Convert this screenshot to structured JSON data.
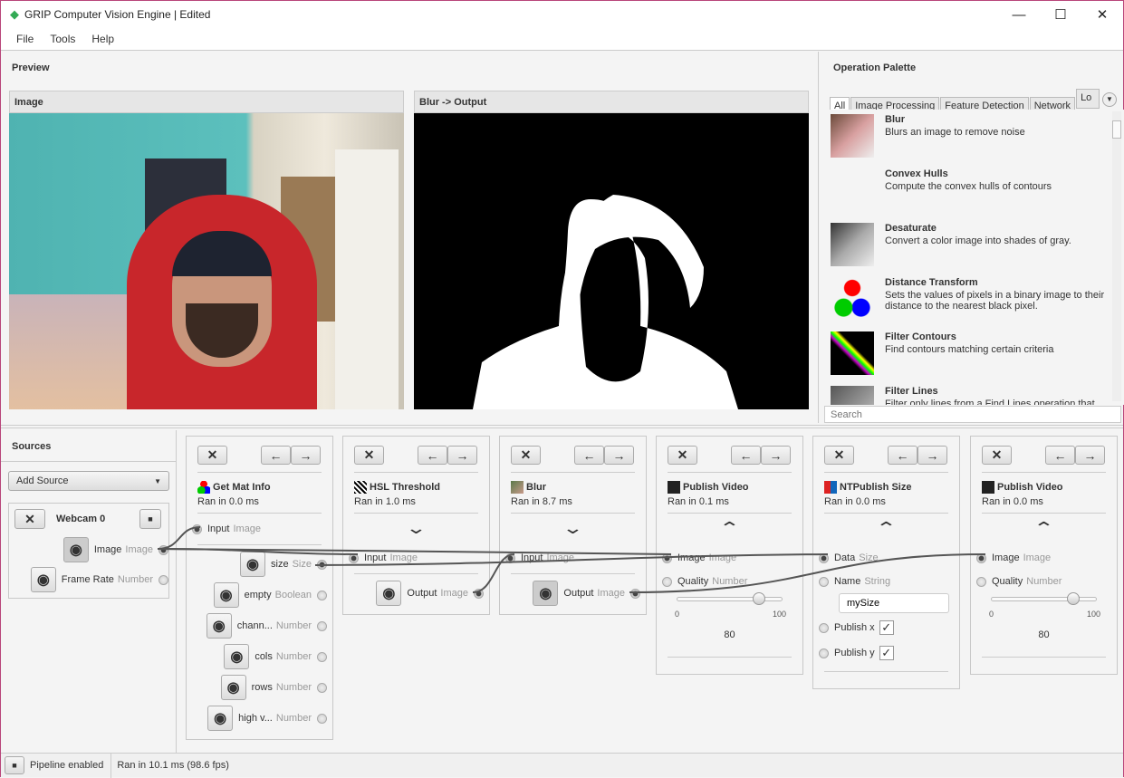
{
  "window": {
    "title": "GRIP Computer Vision Engine | Edited",
    "minimize": "—",
    "maximize": "☐",
    "close": "✕"
  },
  "menu": [
    "File",
    "Tools",
    "Help"
  ],
  "preview": {
    "title": "Preview",
    "panels": [
      {
        "title": "Image"
      },
      {
        "title": "Blur -> Output"
      }
    ]
  },
  "palette": {
    "title": "Operation Palette",
    "tabs": [
      "All",
      "Image Processing",
      "Feature Detection",
      "Network",
      "Lo"
    ],
    "search_placeholder": "Search",
    "items": [
      {
        "name": "Blur",
        "desc": "Blurs an image to remove noise"
      },
      {
        "name": "Convex Hulls",
        "desc": "Compute the convex hulls of contours"
      },
      {
        "name": "Desaturate",
        "desc": "Convert a color image into shades of gray."
      },
      {
        "name": "Distance Transform",
        "desc": "Sets the values of pixels in a binary image to their distance to the nearest black pixel."
      },
      {
        "name": "Filter Contours",
        "desc": "Find contours matching certain criteria"
      },
      {
        "name": "Filter Lines",
        "desc": "Filter only lines from a Find Lines operation that"
      }
    ]
  },
  "sources": {
    "title": "Sources",
    "add_source": "Add Source",
    "webcam": {
      "name": "Webcam 0",
      "outputs": [
        {
          "name": "Image",
          "type": "Image"
        },
        {
          "name": "Frame Rate",
          "type": "Number"
        }
      ]
    }
  },
  "steps": [
    {
      "name": "Get Mat Info",
      "ran": "Ran in 0.0 ms",
      "icon": "opencv-logo-icon",
      "inputs": [
        {
          "name": "Input",
          "type": "Image",
          "connected": true
        }
      ],
      "outputs": [
        {
          "name": "size",
          "type": "Size",
          "connected": true
        },
        {
          "name": "empty",
          "type": "Boolean"
        },
        {
          "name": "chann...",
          "type": "Number"
        },
        {
          "name": "cols",
          "type": "Number"
        },
        {
          "name": "rows",
          "type": "Number"
        },
        {
          "name": "high v...",
          "type": "Number"
        }
      ]
    },
    {
      "name": "HSL Threshold",
      "ran": "Ran in 1.0 ms",
      "icon": "threshold-icon",
      "collapsed": true,
      "inputs": [
        {
          "name": "Input",
          "type": "Image",
          "connected": true
        }
      ],
      "outputs": [
        {
          "name": "Output",
          "type": "Image",
          "connected": true
        }
      ]
    },
    {
      "name": "Blur",
      "ran": "Ran in 8.7 ms",
      "icon": "blur-icon",
      "collapsed": true,
      "inputs": [
        {
          "name": "Input",
          "type": "Image",
          "connected": true
        }
      ],
      "outputs": [
        {
          "name": "Output",
          "type": "Image",
          "connected": true,
          "previewing": true
        }
      ]
    },
    {
      "name": "Publish Video",
      "ran": "Ran in 0.1 ms",
      "icon": "video-camera-icon",
      "inputs": [
        {
          "name": "Image",
          "type": "Image",
          "connected": true
        },
        {
          "name": "Quality",
          "type": "Number",
          "slider": {
            "min": "0",
            "max": "100",
            "value": 80
          }
        }
      ],
      "outputs": []
    },
    {
      "name": "NTPublish Size",
      "ran": "Ran in 0.0 ms",
      "icon": "networktables-icon",
      "inputs": [
        {
          "name": "Data",
          "type": "Size",
          "connected": true
        },
        {
          "name": "Name",
          "type": "String",
          "text": "mySize"
        },
        {
          "name": "Publish x",
          "check": true
        },
        {
          "name": "Publish y",
          "check": true
        }
      ],
      "outputs": []
    },
    {
      "name": "Publish Video",
      "ran": "Ran in 0.0 ms",
      "icon": "video-camera-icon",
      "inputs": [
        {
          "name": "Image",
          "type": "Image",
          "connected": true
        },
        {
          "name": "Quality",
          "type": "Number",
          "slider": {
            "min": "0",
            "max": "100",
            "value": 80
          }
        }
      ],
      "outputs": []
    }
  ],
  "status": {
    "pipeline": "Pipeline enabled",
    "timing": "Ran in 10.1 ms (98.6 fps)"
  }
}
